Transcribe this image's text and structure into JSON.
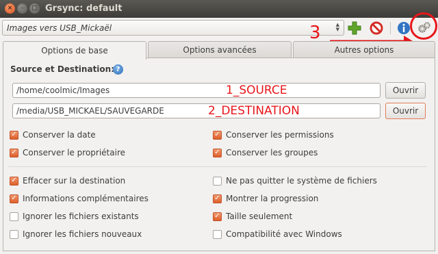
{
  "window": {
    "title": "Grsync: default"
  },
  "toolbar": {
    "session": "Images vers USB_Mickaël",
    "icons": [
      "add-icon",
      "delete-icon",
      "info-icon",
      "preferences-icon"
    ]
  },
  "annotations": {
    "three": "3",
    "source": "1_SOURCE",
    "destination": "2_DESTINATION"
  },
  "tabs": [
    {
      "label": "Options de base",
      "active": true
    },
    {
      "label": "Options avancées",
      "active": false
    },
    {
      "label": "Autres options",
      "active": false
    }
  ],
  "basic": {
    "section_label": "Source et Destination:",
    "source": {
      "value": "/home/coolmic/Images",
      "button": "Ouvrir"
    },
    "destination": {
      "value": "/media/USB_MICKAEL/SAUVEGARDE",
      "button": "Ouvrir"
    },
    "options": [
      {
        "label": "Conserver la date",
        "checked": true
      },
      {
        "label": "Conserver les permissions",
        "checked": true
      },
      {
        "label": "Conserver le propriétaire",
        "checked": true
      },
      {
        "label": "Conserver les groupes",
        "checked": true
      },
      {
        "label": "Effacer sur la destination",
        "checked": true
      },
      {
        "label": "Ne pas quitter le système de fichiers",
        "checked": false
      },
      {
        "label": "Informations complémentaires",
        "checked": true
      },
      {
        "label": "Montrer la progression",
        "checked": true
      },
      {
        "label": "Ignorer les fichiers existants",
        "checked": false
      },
      {
        "label": "Taille seulement",
        "checked": true
      },
      {
        "label": "Ignorer les fichiers nouveaux",
        "checked": false
      },
      {
        "label": "Compatibilité avec Windows",
        "checked": false
      }
    ]
  },
  "colors": {
    "accent": "#dd5f2b",
    "annotation": "#e8161b"
  }
}
